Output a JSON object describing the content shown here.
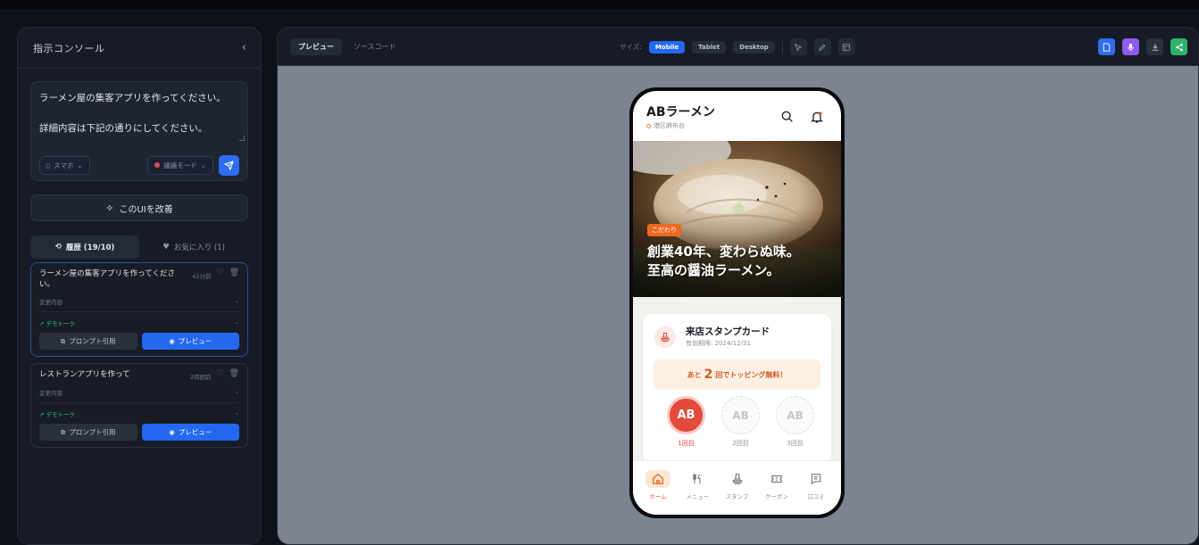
{
  "left_panel": {
    "title": "指示コンソール",
    "prompt_line1": "ラーメン屋の集客アプリを作ってください。",
    "prompt_line2": "詳細内容は下記の通りにしてください。",
    "device_select": "スマホ",
    "mode_select": "議論モード",
    "improve_label": "このUIを改善",
    "tabs": [
      {
        "label": "履歴 (19/10)"
      },
      {
        "label": "お気に入り (1)"
      }
    ],
    "history": [
      {
        "title": "ラーメン屋の集客アプリを作ってください。",
        "time": "42分前",
        "changes": "変更内容",
        "demo": "デモトーク",
        "quote": "プロンプト引用",
        "preview": "プレビュー"
      },
      {
        "title": "レストランアプリを作って",
        "time": "2時間前",
        "changes": "変更内容",
        "demo": "デモトーク",
        "quote": "プロンプト引用",
        "preview": "プレビュー"
      }
    ]
  },
  "toolbar": {
    "tab_preview": "プレビュー",
    "tab_source": "ソースコード",
    "size_label": "サイズ:",
    "sizes": [
      "Mobile",
      "Tablet",
      "Desktop"
    ],
    "active_size": "Mobile",
    "colors": {
      "accent": "#2468f0",
      "doc": "#2f6cf0",
      "mic": "#8e5be8",
      "share": "#2fb36a"
    }
  },
  "app": {
    "shop_name": "ABラーメン",
    "location": "港区麻布台",
    "hero_tag": "こだわり",
    "hero_line1": "創業40年、変わらぬ味。",
    "hero_line2": "至高の醤油ラーメン。",
    "card_title": "来店スタンプカード",
    "card_expiry": "有効期限: 2024/12/31",
    "banner_pre": "あと",
    "banner_num": "2",
    "banner_post": "回でトッピング無料！",
    "stamps": [
      {
        "mark": "AB",
        "label": "1回目",
        "stamped": true
      },
      {
        "mark": "AB",
        "label": "2回目",
        "stamped": false
      },
      {
        "mark": "AB",
        "label": "3回目",
        "stamped": false
      }
    ],
    "tabs": [
      {
        "label": "ホーム",
        "icon": "home-icon"
      },
      {
        "label": "メニュー",
        "icon": "utensils-icon"
      },
      {
        "label": "スタンプ",
        "icon": "stamp-icon"
      },
      {
        "label": "クーポン",
        "icon": "ticket-icon"
      },
      {
        "label": "口コミ",
        "icon": "review-icon"
      }
    ],
    "colors": {
      "accent": "#ec6a1f",
      "stamp": "#e24a3b"
    }
  }
}
